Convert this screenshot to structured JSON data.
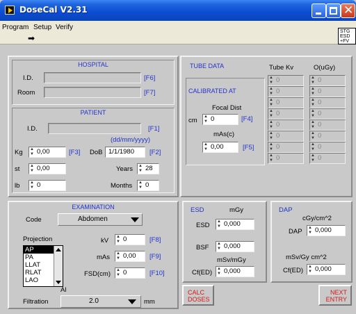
{
  "window": {
    "title": "DoseCal V2.31"
  },
  "menu": {
    "items": [
      "Program",
      "Setup",
      "Verify"
    ],
    "status_box": [
      "STG",
      "ESD",
      "+FV"
    ]
  },
  "hospital": {
    "title": "HOSPITAL",
    "id_label": "I.D.",
    "id_key": "[F6]",
    "id_value": "",
    "room_label": "Room",
    "room_key": "[F7]",
    "room_value": ""
  },
  "patient": {
    "title": "PATIENT",
    "id_label": "I.D.",
    "id_key": "[F1]",
    "id_value": "",
    "date_format": "(dd/mm/yyyy)",
    "kg_label": "Kg",
    "kg_value": "0,00",
    "kg_key": "[F3]",
    "dob_label": "DoB",
    "dob_value": "1/1/1980",
    "dob_key": "[F2]",
    "st_label": "st",
    "st_value": "0,00",
    "years_label": "Years",
    "years_value": "28",
    "lb_label": "lb",
    "lb_value": "0",
    "months_label": "Months",
    "months_value": "0"
  },
  "tube_data": {
    "title": "TUBE DATA",
    "calibrated_title": "CALIBRATED AT",
    "focal_label": "Focal Dist",
    "cm_label": "cm",
    "focal_value": "0",
    "focal_key": "[F4]",
    "mas_label": "mAs(c)",
    "mas_value": "0,00",
    "mas_key": "[F5]",
    "kv_col_label": "Tube Kv",
    "o_col_label": "O(uGy)",
    "kv_values": [
      "0",
      "0",
      "0",
      "0",
      "0",
      "0",
      "0",
      "0"
    ],
    "o_values": [
      "0",
      "0",
      "0",
      "0",
      "0",
      "0",
      "0",
      "0"
    ]
  },
  "examination": {
    "title": "EXAMINATION",
    "code_label": "Code",
    "code_value": "Abdomen",
    "projection_label": "Projection",
    "projections": [
      "AP",
      "PA",
      "LLAT",
      "RLAT",
      "LAO"
    ],
    "selected_projection": "AP",
    "kv_label": "kV",
    "kv_value": "0",
    "kv_key": "[F8]",
    "mas_label": "mAs",
    "mas_value": "0,00",
    "mas_key": "[F9]",
    "fsd_label": "FSD(cm)",
    "fsd_value": "0",
    "fsd_key": "[F10]",
    "al_label": "Al",
    "filtration_label": "Filtration",
    "filtration_value": "2.0",
    "filtration_unit": "mm"
  },
  "esd": {
    "title": "ESD",
    "unit": "mGy",
    "esd_label": "ESD",
    "esd_value": "0,000",
    "bsf_label": "BSF",
    "bsf_value": "0,000",
    "cf_unit": "mSv/mGy",
    "cf_label": "Cf(ED)",
    "cf_value": "0,000"
  },
  "dap": {
    "title": "DAP",
    "unit": "cGy/cm^2",
    "dap_label": "DAP",
    "dap_value": "0,000",
    "cf_unit": "mSv/Gy cm^2",
    "cf_label": "Cf(ED)",
    "cf_value": "0,000"
  },
  "buttons": {
    "calc": [
      "CALC",
      "DOSES"
    ],
    "next": [
      "NEXT",
      "ENTRY"
    ]
  }
}
